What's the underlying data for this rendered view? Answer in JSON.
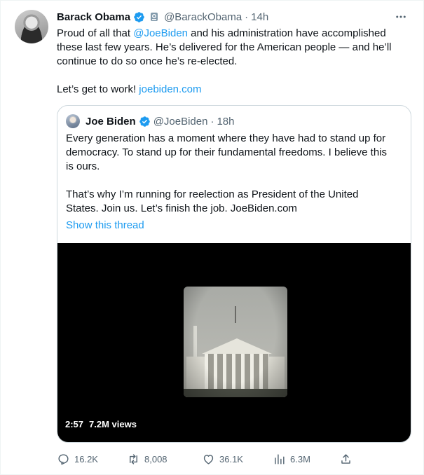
{
  "colors": {
    "accent": "#1d9bf0",
    "verified": "#1d9bf0",
    "text_primary": "#0f1419",
    "text_secondary": "#536471",
    "border": "#cfd9de"
  },
  "tweet": {
    "author_name": "Barack Obama",
    "author_handle": "@BarackObama",
    "separator": "·",
    "time": "14h",
    "more_icon": "more-icon",
    "text": {
      "line1_prefix": "Proud of all that ",
      "mention": "@JoeBiden",
      "line1_suffix": " and his administration have accomplished",
      "line2": "these last few years. He’s delivered for the American people — and he’ll",
      "line3": "continue to do so once he’s re-elected.",
      "line4_prefix": "Let’s get to work! ",
      "link": "joebiden.com"
    }
  },
  "quoted_tweet": {
    "author_name": "Joe Biden",
    "author_handle": "@JoeBiden",
    "separator": "·",
    "time": "18h",
    "text": {
      "line1": "Every generation has a moment where they have had to stand up for",
      "line2": "democracy. To stand up for their fundamental freedoms. I believe this",
      "line3": "is ours.",
      "line4": "That’s why I’m running for reelection as President of the United",
      "line5": "States. Join us. Let’s finish the job. JoeBiden.com"
    },
    "show_thread": "Show this thread",
    "video": {
      "duration": "2:57",
      "views": "7.2M views"
    }
  },
  "actions": {
    "replies": "16.2K",
    "retweets": "8,008",
    "likes": "36.1K",
    "views": "6.3M"
  }
}
